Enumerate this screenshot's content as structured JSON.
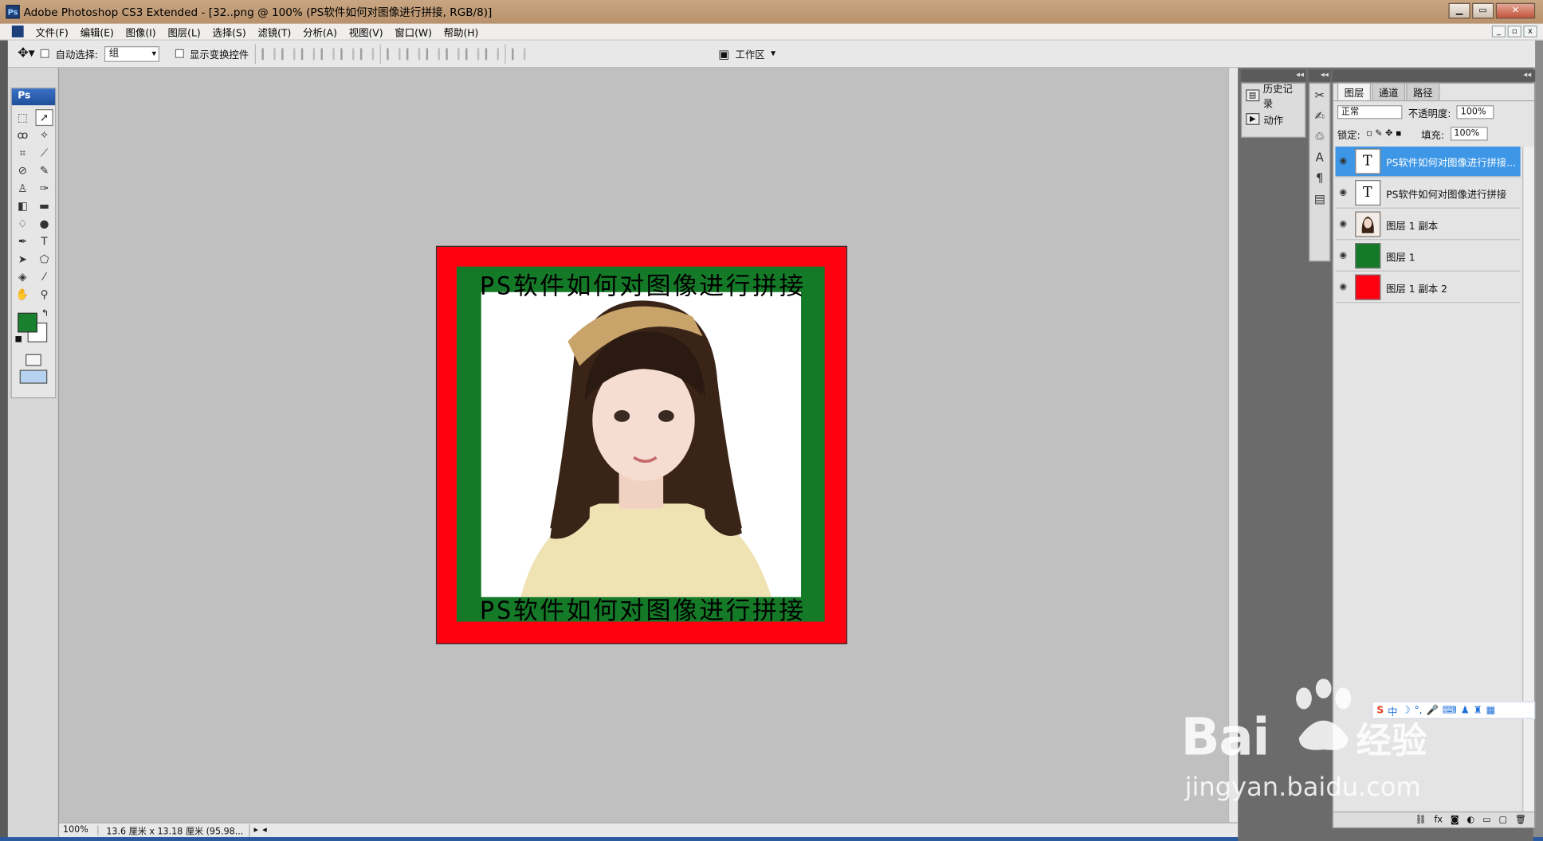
{
  "window": {
    "title": "Adobe Photoshop CS3 Extended - [32..png @ 100% (PS软件如何对图像进行拼接, RGB/8)]",
    "app_icon": "Ps"
  },
  "menu": [
    "文件(F)",
    "编辑(E)",
    "图像(I)",
    "图层(L)",
    "选择(S)",
    "滤镜(T)",
    "分析(A)",
    "视图(V)",
    "窗口(W)",
    "帮助(H)"
  ],
  "options_bar": {
    "auto_select_label": "自动选择:",
    "auto_select_value": "组",
    "show_transform_label": "显示变换控件",
    "workspace_label": "工作区"
  },
  "toolbox": {
    "header": "Ps",
    "foreground_color": "#17812d",
    "background_color": "#ffffff"
  },
  "document": {
    "caption_top": "PS软件如何对图像进行拼接",
    "caption_bottom": "PS软件如何对图像进行拼接",
    "colors": {
      "outer": "#ff0010",
      "inner": "#157a27",
      "photo_bg": "#ffffff"
    }
  },
  "status": {
    "zoom": "100%",
    "doc_info": "13.6 厘米 x 13.18 厘米 (95.98..."
  },
  "history_panel": {
    "items": [
      {
        "label": "历史记录",
        "icon": "history-icon"
      },
      {
        "label": "动作",
        "icon": "actions-icon"
      }
    ]
  },
  "layers_panel": {
    "tabs": [
      "图层",
      "通道",
      "路径"
    ],
    "blend_mode": "正常",
    "opacity_label": "不透明度:",
    "opacity_value": "100%",
    "lock_label": "锁定:",
    "fill_label": "填充:",
    "fill_value": "100%",
    "layers": [
      {
        "name": "PS软件如何对图像进行拼接...",
        "thumb": "T",
        "type": "text",
        "selected": true
      },
      {
        "name": "PS软件如何对图像进行拼接",
        "thumb": "T",
        "type": "text",
        "selected": false
      },
      {
        "name": "图层 1 副本",
        "thumb": "",
        "type": "photo",
        "selected": false
      },
      {
        "name": "图层 1",
        "thumb": "",
        "type": "fill",
        "color": "#157a27",
        "selected": false
      },
      {
        "name": "图层 1 副本 2",
        "thumb": "",
        "type": "fill",
        "color": "#ff0010",
        "selected": false
      }
    ]
  },
  "ime_bar": {
    "brand": "S",
    "mode": "中"
  },
  "watermark": {
    "line1": "Bai",
    "line2": "经验",
    "line3": "jingyan.baidu.com"
  }
}
